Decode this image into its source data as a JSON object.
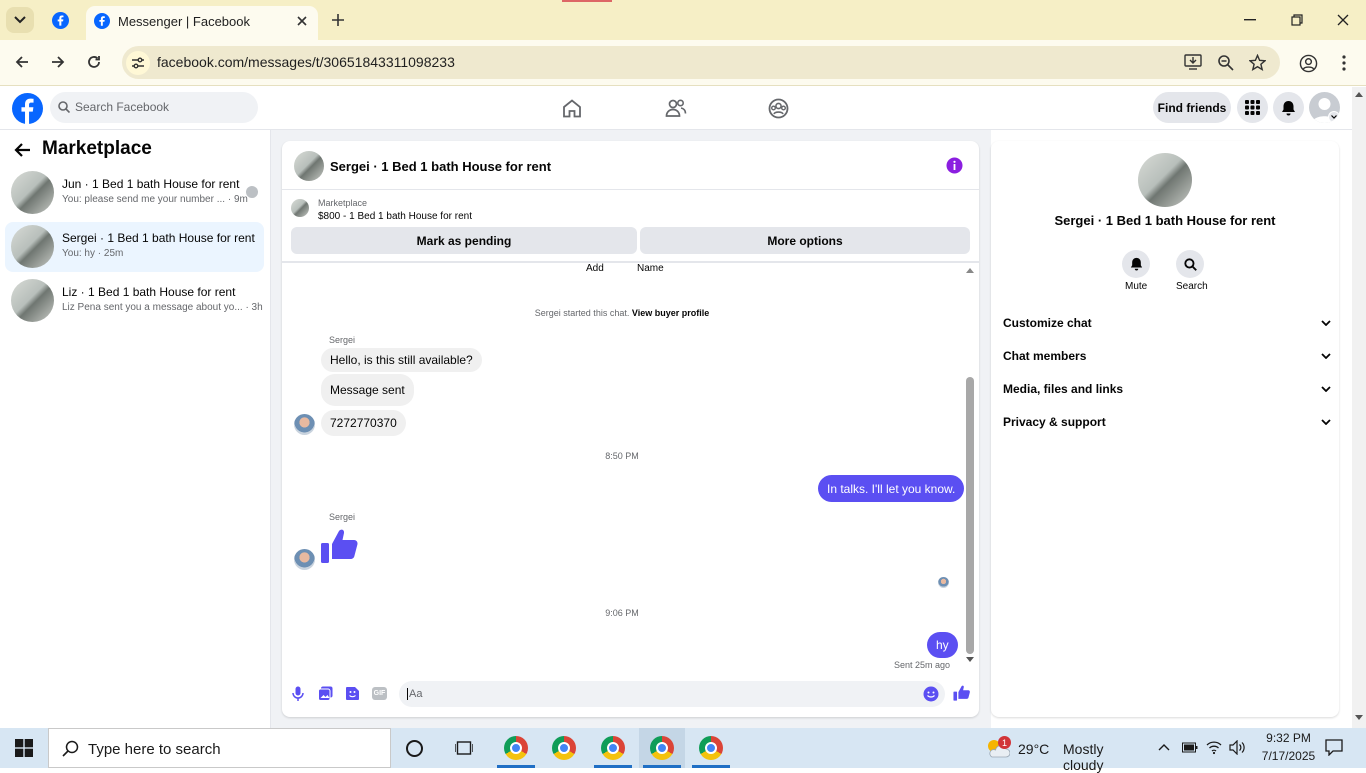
{
  "browser": {
    "tab_title": "Messenger | Facebook",
    "url": "facebook.com/messages/t/30651843311098233",
    "icons": [
      "tab-search-icon",
      "facebook-icon",
      "close-icon",
      "new-tab-icon",
      "back-icon",
      "forward-icon",
      "reload-icon",
      "site-info-icon",
      "install-icon",
      "zoom-icon",
      "star-icon",
      "profile-icon",
      "menu-icon"
    ]
  },
  "fb_header": {
    "search_placeholder": "Search Facebook",
    "find_friends_label": "Find friends"
  },
  "left_pane": {
    "title": "Marketplace",
    "conversations": [
      {
        "name": "Jun · 1 Bed 1 bath House for rent",
        "preview": "You: please send me your number ... · 9m"
      },
      {
        "name": "Sergei · 1 Bed 1 bath House for rent",
        "preview": "You: hy · 25m"
      },
      {
        "name": "Liz · 1 Bed 1 bath House for rent",
        "preview": "Liz Pena sent you a message about yo... · 3h"
      }
    ]
  },
  "chat": {
    "title": "Sergei · 1 Bed 1 bath House for rent",
    "listing_source": "Marketplace",
    "listing_price_title": "$800 - 1 Bed 1 bath House for rent",
    "mark_pending_label": "Mark as pending",
    "more_options_label": "More options",
    "top_labels": [
      "Add",
      "Name"
    ],
    "started_text": "Sergei started this chat.",
    "view_buyer_profile": "View buyer profile",
    "sender_name": "Sergei",
    "messages_in_1": [
      "Hello, is this still available?",
      "Message sent",
      "7272770370"
    ],
    "time_1": "8:50 PM",
    "message_out_1": "In talks. I'll let you know.",
    "sender_name_2": "Sergei",
    "time_2": "9:06 PM",
    "message_out_2": "hy",
    "sent_status": "Sent 25m ago",
    "composer_placeholder": "Aa"
  },
  "details": {
    "title": "Sergei · 1 Bed 1 bath House for rent",
    "mute_label": "Mute",
    "search_label": "Search",
    "sections": [
      "Customize chat",
      "Chat members",
      "Media, files and links",
      "Privacy & support"
    ]
  },
  "taskbar": {
    "search_placeholder": "Type here to search",
    "weather_temp": "29°C",
    "weather_text": "Mostly cloudy",
    "weather_badge": "1",
    "time": "9:32 PM",
    "date": "7/17/2025"
  },
  "colors": {
    "accent": "#5b4ff2",
    "fb_blue": "#0866ff",
    "chrome_tab_bg": "#f6efc6"
  }
}
